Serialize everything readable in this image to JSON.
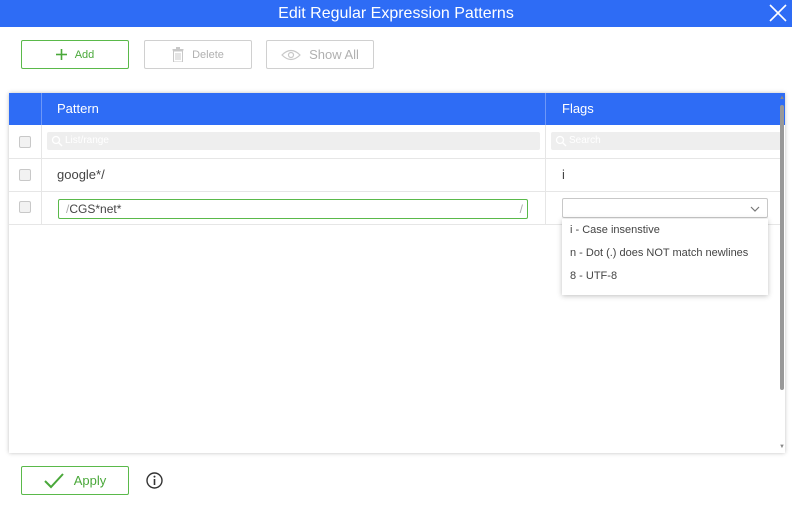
{
  "dialog": {
    "title": "Edit Regular Expression Patterns"
  },
  "toolbar": {
    "add_label": "Add",
    "delete_label": "Delete",
    "show_all_label": "Show All"
  },
  "grid": {
    "columns": [
      {
        "label": "Pattern"
      },
      {
        "label": "Flags"
      }
    ],
    "filters": {
      "pattern_placeholder": "List/range",
      "flags_placeholder": "Search"
    },
    "rows": [
      {
        "pattern": "google*/",
        "flags": "i"
      }
    ],
    "editing_row": {
      "pattern_start": "/",
      "pattern_value": "CGS*net*",
      "pattern_end": "/",
      "flags_value": ""
    }
  },
  "flags_dropdown": {
    "options": [
      {
        "label": "i - Case insenstive"
      },
      {
        "label": "n - Dot (.) does NOT match newlines"
      },
      {
        "label": "8 - UTF-8"
      }
    ]
  },
  "footer": {
    "apply_label": "Apply"
  },
  "colors": {
    "header_blue": "#2e6cf5",
    "accent_green": "#5ab94a"
  }
}
